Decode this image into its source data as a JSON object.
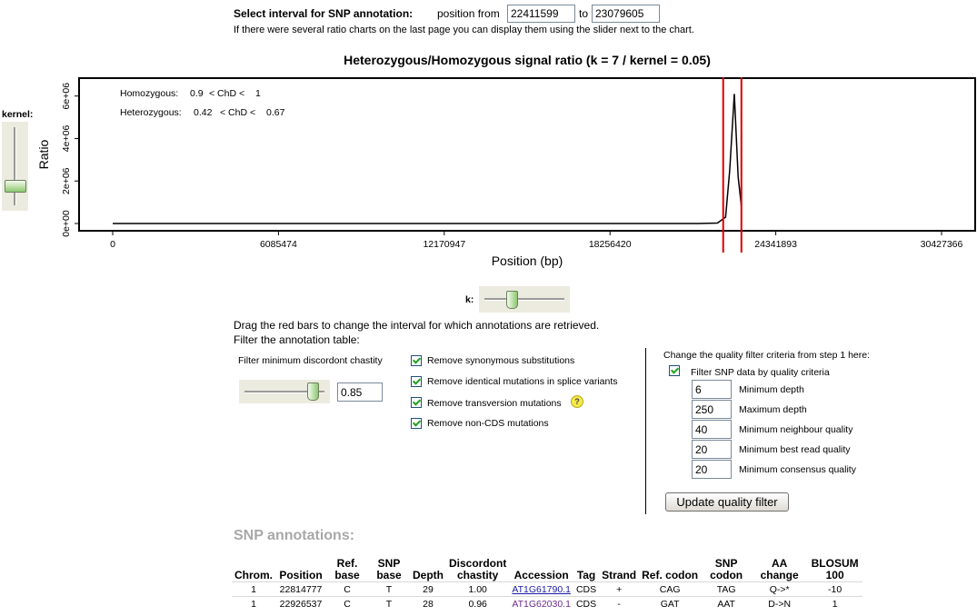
{
  "interval": {
    "label": "Select interval for SNP annotation:",
    "from_label": "position from",
    "from_value": "22411599",
    "to_label": "to",
    "to_value": "23079605",
    "hint": "If there were several ratio charts on the last page you can display them using the slider next to the chart."
  },
  "kernel_slider": {
    "label": "kernel:"
  },
  "chart_data": {
    "type": "line",
    "title": "Heterozygous/Homozygous signal ratio (k = 7 / kernel = 0.05)",
    "xlabel": "Position (bp)",
    "ylabel": "Ratio",
    "x_ticks": [
      "0",
      "6085474",
      "12170947",
      "18256420",
      "24341893",
      "30427366"
    ],
    "y_ticks": [
      "0e+00",
      "2e+06",
      "4e+06",
      "6e+06"
    ],
    "xlim": [
      0,
      30427366
    ],
    "ylim": [
      0,
      6500000
    ],
    "annotations": [
      {
        "name": "Homozygous:",
        "low": "0.9",
        "mid": "< ChD <",
        "high": "1"
      },
      {
        "name": "Heterozygous:",
        "low": "0.42",
        "mid": "< ChD <",
        "high": "0.67"
      }
    ],
    "series": [
      {
        "x": [
          0,
          18000000,
          21500000,
          22200000,
          22500000,
          22650000,
          22820000,
          22960000,
          23079605
        ],
        "y": [
          0,
          0,
          0,
          20000,
          300000,
          2500000,
          6100000,
          2200000,
          800000
        ]
      }
    ],
    "interval_bars": [
      22411599,
      23079605
    ],
    "colors": {
      "line": "#000000",
      "interval": "#e00000"
    }
  },
  "k_slider": {
    "label": "k:"
  },
  "instructions": {
    "drag": "Drag the red bars to change the interval for which annotations are retrieved.",
    "filter": "Filter the annotation table:"
  },
  "chastity": {
    "label": "Filter minimum discordont chastity",
    "value": "0.85"
  },
  "filters": [
    {
      "label": "Remove synonymous substitutions",
      "checked": true
    },
    {
      "label": "Remove identical mutations in splice variants",
      "checked": true
    },
    {
      "label": "Remove transversion mutations",
      "checked": true,
      "help": "?"
    },
    {
      "label": "Remove non-CDS mutations",
      "checked": true
    }
  ],
  "quality": {
    "heading": "Change the quality filter criteria from step 1 here:",
    "toggle_label": "Filter SNP data by quality criteria",
    "fields": [
      {
        "value": "6",
        "label": "Minimum depth"
      },
      {
        "value": "250",
        "label": "Maximum depth"
      },
      {
        "value": "40",
        "label": "Minimum neighbour quality"
      },
      {
        "value": "20",
        "label": "Minimum best read quality"
      },
      {
        "value": "20",
        "label": "Minimum consensus quality"
      }
    ],
    "button": "Update quality filter"
  },
  "snp": {
    "title": "SNP annotations:",
    "headers": [
      "Chrom.",
      "Position",
      "Ref. base",
      "SNP base",
      "Depth",
      "Discordont chastity",
      "Accession",
      "Tag",
      "Strand",
      "Ref. codon",
      "SNP codon",
      "AA change",
      "BLOSUM 100"
    ],
    "rows": [
      [
        "1",
        "22814777",
        "C",
        "T",
        "29",
        "1.00",
        "AT1G61790.1",
        "CDS",
        "+",
        "CAG",
        "TAG",
        "Q->*",
        "-10"
      ],
      [
        "1",
        "22926537",
        "C",
        "T",
        "28",
        "0.96",
        "AT1G62030.1",
        "CDS",
        "-",
        "GAT",
        "AAT",
        "D->N",
        "1"
      ]
    ]
  }
}
